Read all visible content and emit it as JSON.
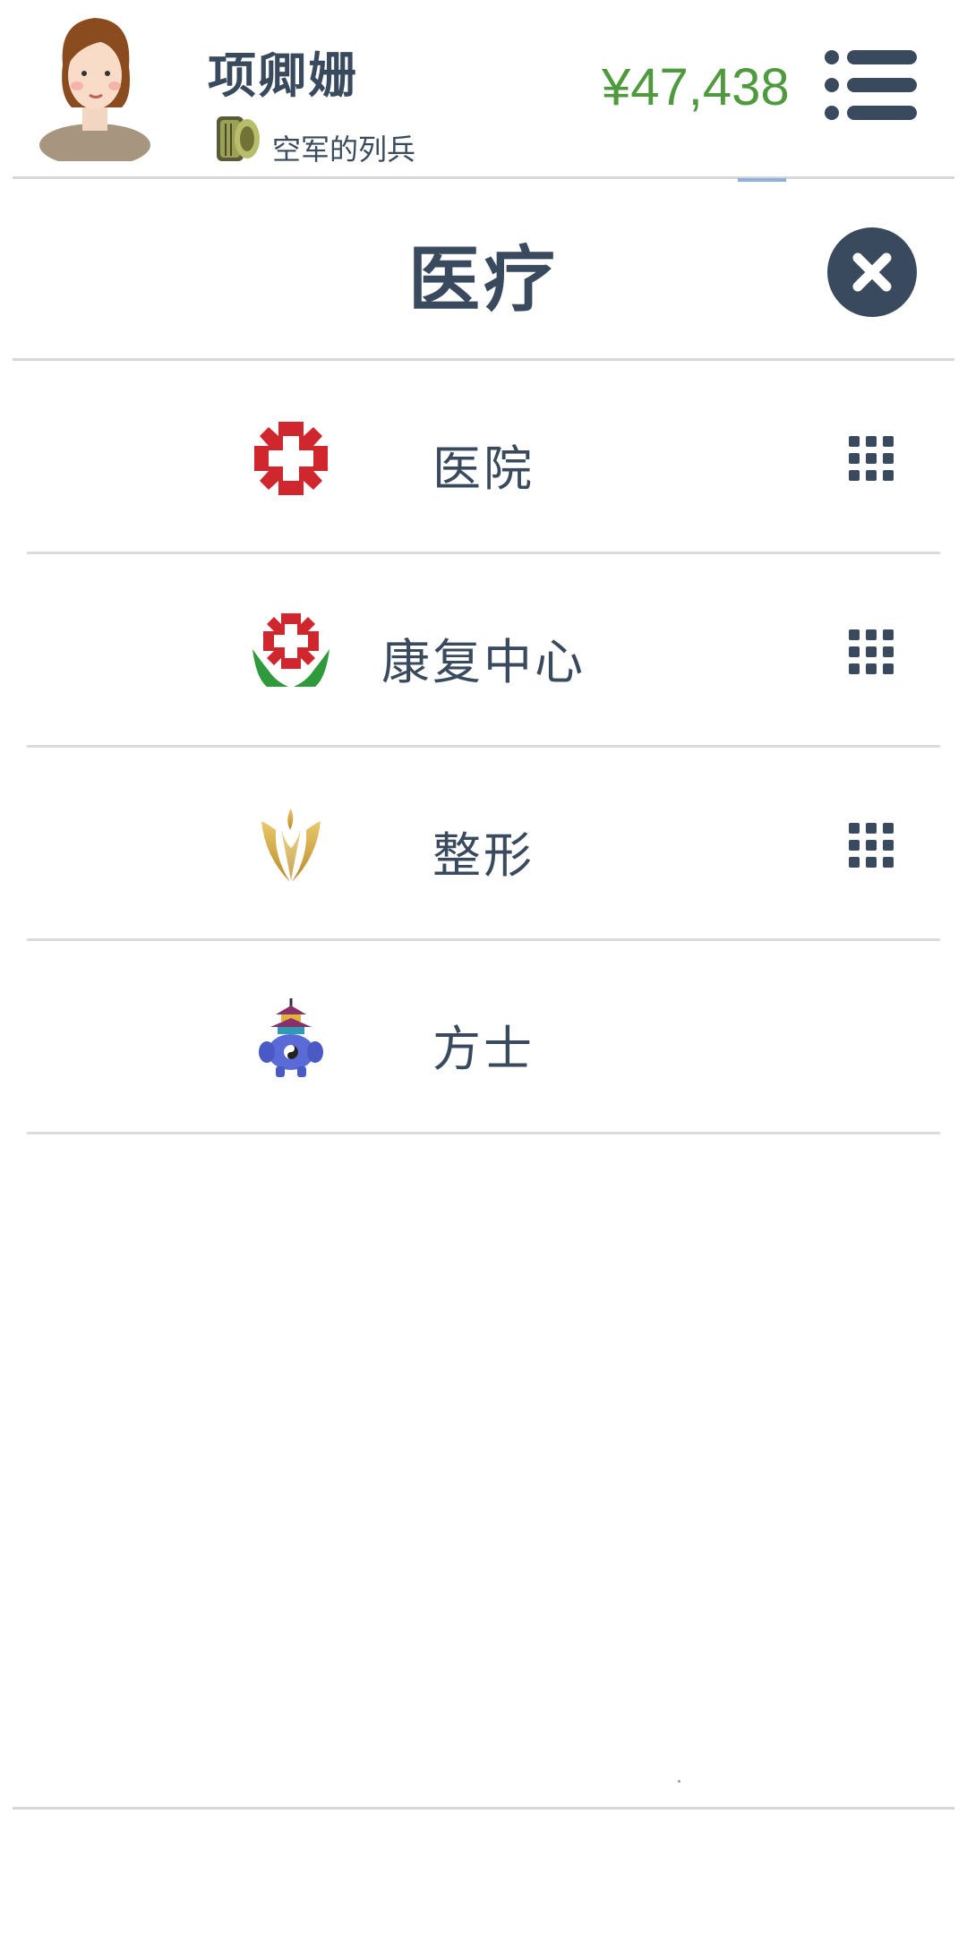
{
  "header": {
    "username": "项卿姗",
    "rank": "空军的列兵",
    "balance": "¥47,438",
    "avatar_icon": "female-avatar-icon",
    "rank_icon": "rank-badge-icon",
    "menu_icon": "list-menu-icon"
  },
  "panel": {
    "title": "医疗",
    "close_icon": "close-circle-icon"
  },
  "items": [
    {
      "label": "医院",
      "icon": "red-cross-icon",
      "has_grid": true
    },
    {
      "label": "康复中心",
      "icon": "rehab-cross-hands-icon",
      "has_grid": true
    },
    {
      "label": "整形",
      "icon": "golden-flower-icon",
      "has_grid": true
    },
    {
      "label": "方士",
      "icon": "pagoda-creature-icon",
      "has_grid": false
    }
  ],
  "colors": {
    "text": "#3a4a5e",
    "balance": "#4f9a3e",
    "divider": "#d7d7d7",
    "cross_red": "#d0272e",
    "leaf_green": "#2e9a3c"
  }
}
